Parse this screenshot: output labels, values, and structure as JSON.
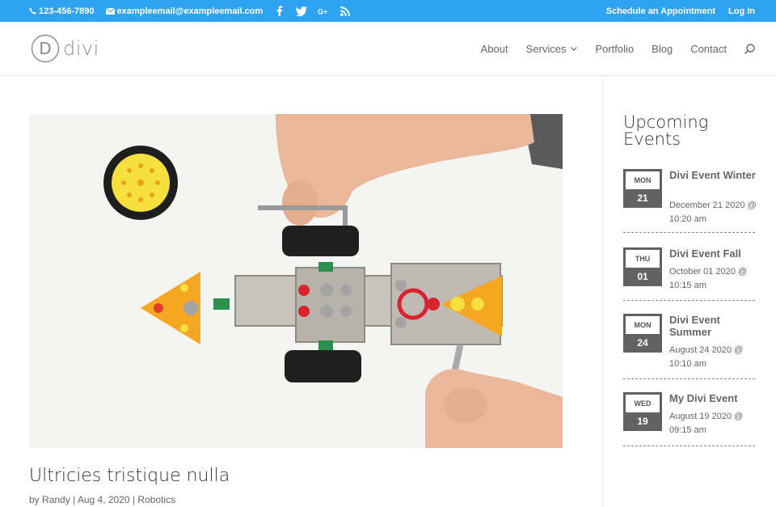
{
  "topbar": {
    "phone": "123-456-7890",
    "email": "exampleemail@exampleemail.com",
    "social": [
      "facebook-icon",
      "twitter-icon",
      "google-plus-icon",
      "rss-icon"
    ],
    "schedule_link": "Schedule an Appointment",
    "login_link": "Log In",
    "bg_color": "#2ea3f2"
  },
  "header": {
    "logo_letter": "D",
    "logo_text": "divi",
    "nav": [
      {
        "label": "About"
      },
      {
        "label": "Services"
      },
      {
        "label": "Portfolio"
      },
      {
        "label": "Blog"
      },
      {
        "label": "Contact"
      }
    ]
  },
  "post": {
    "image_alt": "robotics kit",
    "title": "Ultricies tristique nulla",
    "meta_by": "by",
    "author": "Randy",
    "date": "Aug 4, 2020",
    "category": "Robotics",
    "separator": "|"
  },
  "sidebar": {
    "widget_title": "Upcoming Events",
    "events": [
      {
        "dow": "MON",
        "day": "21",
        "title": "Divi Event Winter",
        "date": "December 21 2020 @ 10:20 am"
      },
      {
        "dow": "THU",
        "day": "01",
        "title": "Divi Event Fall",
        "date": "October 01 2020 @ 10:15 am"
      },
      {
        "dow": "MON",
        "day": "24",
        "title": "Divi Event Summer",
        "date": "August 24 2020 @ 10:10 am"
      },
      {
        "dow": "WED",
        "day": "19",
        "title": "My Divi Event",
        "date": "August 19 2020 @ 09:15 am"
      }
    ]
  }
}
